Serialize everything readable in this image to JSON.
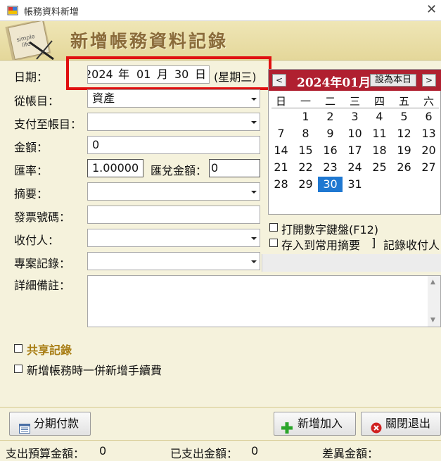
{
  "window": {
    "title": "帳務資料新增",
    "close": "✕"
  },
  "banner": {
    "title": "新增帳務資料記錄",
    "notebook_text": "simple life"
  },
  "form": {
    "date_label": "日期：",
    "date_value": {
      "year": "2024",
      "year_unit": "年",
      "month": "01",
      "month_unit": "月",
      "day": "30",
      "day_unit": "日"
    },
    "weekday": "(星期三)",
    "from_account_label": "從帳目：",
    "from_account_value": "資產",
    "pay_to_label": "支付至帳目：",
    "pay_to_value": "",
    "amount_label": "金額：",
    "amount_value": "0",
    "rate_label": "匯率：",
    "rate_value": "1.00000",
    "exchange_amount_label": "匯兌金額：",
    "exchange_amount_value": "0",
    "summary_label": "摘要：",
    "summary_value": "",
    "invoice_label": "發票號碼：",
    "invoice_value": "",
    "payee_label": "收付人：",
    "payee_value": "",
    "project_label": "專案記錄：",
    "project_value": "",
    "notes_label": "詳細備註：",
    "notes_value": ""
  },
  "calendar": {
    "title": "2024年01月",
    "prev": "<",
    "next": ">",
    "today_button": "設為本日",
    "dow": [
      "日",
      "一",
      "二",
      "三",
      "四",
      "五",
      "六"
    ],
    "weeks": [
      [
        "",
        "1",
        "2",
        "3",
        "4",
        "5",
        "6"
      ],
      [
        "7",
        "8",
        "9",
        "10",
        "11",
        "12",
        "13"
      ],
      [
        "14",
        "15",
        "16",
        "17",
        "18",
        "19",
        "20"
      ],
      [
        "21",
        "22",
        "23",
        "24",
        "25",
        "26",
        "27"
      ],
      [
        "28",
        "29",
        "30",
        "31",
        "",
        "",
        ""
      ]
    ],
    "selected": "30",
    "selected_color": "#1f78d1",
    "header_color": "#b02030"
  },
  "options": {
    "numeric_keypad": "打開數字鍵盤(F12)",
    "save_common_summary": "存入到常用摘要",
    "record_payee": "記錄收付人",
    "shared_record": "共享記錄",
    "add_fee": "新增帳務時一併新增手續費"
  },
  "buttons": {
    "installment": "分期付款",
    "add": "新增加入",
    "close": "關閉退出"
  },
  "status": {
    "budget_label": "支出預算金額：",
    "budget_value": "0",
    "spent_label": "已支出金額：",
    "spent_value": "0",
    "diff_label": "差異金額：",
    "diff_value": ""
  },
  "icons": [
    "app-icon",
    "close-icon",
    "dropdown-arrow-icon",
    "calendar-list-icon",
    "plus-icon",
    "close-circle-icon"
  ]
}
